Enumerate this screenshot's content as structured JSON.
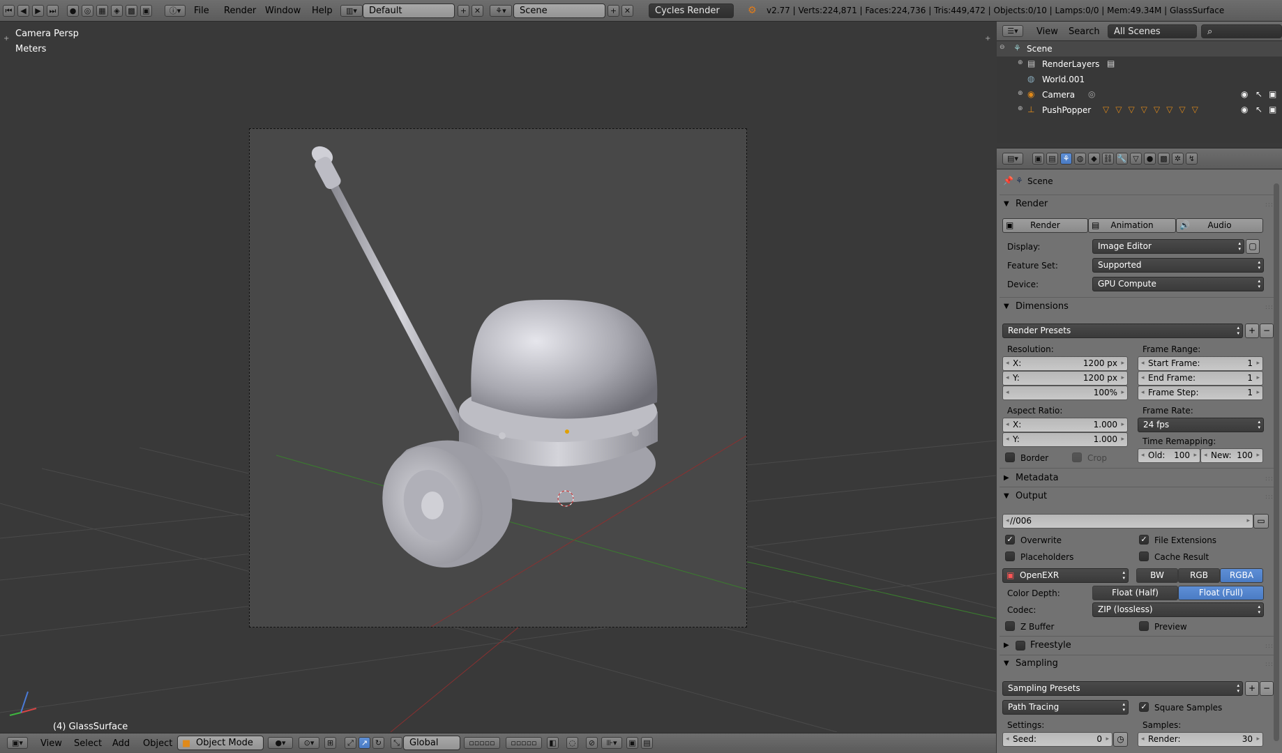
{
  "topbar": {
    "menus": [
      "File",
      "Render",
      "Window",
      "Help"
    ],
    "screen_layout": "Default",
    "scene": "Scene",
    "engine": "Cycles Render",
    "stats": "v2.77 | Verts:224,871 | Faces:224,736 | Tris:449,472 | Objects:0/10 | Lamps:0/0 | Mem:49.34M | GlassSurface"
  },
  "viewport": {
    "view_name": "Camera Persp",
    "units": "Meters",
    "object_label": "(4) GlassSurface"
  },
  "bottombar": {
    "menus": [
      "View",
      "Select",
      "Add",
      "Object"
    ],
    "mode": "Object Mode",
    "orientation": "Global"
  },
  "outliner": {
    "menus": [
      "View",
      "Search"
    ],
    "filter": "All Scenes",
    "items": [
      {
        "label": "Scene"
      },
      {
        "label": "RenderLayers"
      },
      {
        "label": "World.001"
      },
      {
        "label": "Camera"
      },
      {
        "label": "PushPopper"
      }
    ]
  },
  "properties": {
    "context": "Scene",
    "render": {
      "title": "Render",
      "buttons": [
        "Render",
        "Animation",
        "Audio"
      ],
      "display_label": "Display:",
      "display_value": "Image Editor",
      "feature_label": "Feature Set:",
      "feature_value": "Supported",
      "device_label": "Device:",
      "device_value": "GPU Compute"
    },
    "dimensions": {
      "title": "Dimensions",
      "presets": "Render Presets",
      "resolution_label": "Resolution:",
      "res_x_label": "X:",
      "res_x": "1200 px",
      "res_y_label": "Y:",
      "res_y": "1200 px",
      "res_pct": "100%",
      "frame_range_label": "Frame Range:",
      "start_label": "Start Frame:",
      "start": "1",
      "end_label": "End Frame:",
      "end": "1",
      "step_label": "Frame Step:",
      "step": "1",
      "aspect_label": "Aspect Ratio:",
      "asp_x_label": "X:",
      "asp_x": "1.000",
      "asp_y_label": "Y:",
      "asp_y": "1.000",
      "frame_rate_label": "Frame Rate:",
      "frame_rate": "24 fps",
      "time_remap_label": "Time Remapping:",
      "old_label": "Old:",
      "old": "100",
      "new_label": "New:",
      "new": "100",
      "border": "Border",
      "crop": "Crop"
    },
    "metadata": {
      "title": "Metadata"
    },
    "output": {
      "title": "Output",
      "path": "//006",
      "overwrite": "Overwrite",
      "file_ext": "File Extensions",
      "placeholders": "Placeholders",
      "cache": "Cache Result",
      "format": "OpenEXR",
      "color_modes": [
        "BW",
        "RGB",
        "RGBA"
      ],
      "depth_label": "Color Depth:",
      "depths": [
        "Float (Half)",
        "Float (Full)"
      ],
      "codec_label": "Codec:",
      "codec": "ZIP (lossless)",
      "zbuffer": "Z Buffer",
      "preview": "Preview"
    },
    "freestyle": {
      "title": "Freestyle"
    },
    "sampling": {
      "title": "Sampling",
      "presets": "Sampling Presets",
      "integrator": "Path Tracing",
      "square": "Square Samples",
      "settings_label": "Settings:",
      "samples_label": "Samples:",
      "seed_label": "Seed:",
      "seed": "0",
      "render_label": "Render:",
      "render": "30"
    }
  },
  "colors": {
    "selected": "#5680c2",
    "viewport_bg": "#393939",
    "panel_bg": "#727272"
  }
}
